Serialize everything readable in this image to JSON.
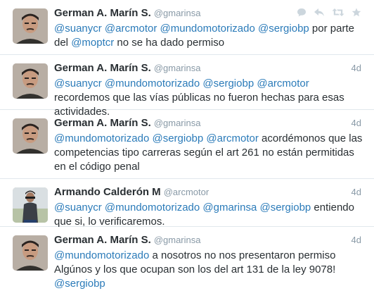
{
  "tweets": [
    {
      "fullname": "German A. Marín S.",
      "username": "@gmarinsa",
      "time": "",
      "show_actions": true,
      "avatar": "photo-man-dark-hair",
      "text_parts": [
        {
          "t": "@suanycr",
          "m": true
        },
        {
          "t": " ",
          "m": false
        },
        {
          "t": "@arcmotor",
          "m": true
        },
        {
          "t": " ",
          "m": false
        },
        {
          "t": "@mundomotorizado",
          "m": true
        },
        {
          "t": " ",
          "m": false
        },
        {
          "t": "@sergiobp",
          "m": true
        },
        {
          "t": " por parte del ",
          "m": false
        },
        {
          "t": "@moptcr",
          "m": true
        },
        {
          "t": "  no se ha dado permiso",
          "m": false
        }
      ]
    },
    {
      "fullname": "German A. Marín S.",
      "username": "@gmarinsa",
      "time": "4d",
      "show_actions": false,
      "avatar": "photo-man-dark-hair",
      "text_parts": [
        {
          "t": "@suanycr",
          "m": true
        },
        {
          "t": " ",
          "m": false
        },
        {
          "t": "@mundomotorizado",
          "m": true
        },
        {
          "t": " ",
          "m": false
        },
        {
          "t": "@sergiobp",
          "m": true
        },
        {
          "t": " ",
          "m": false
        },
        {
          "t": "@arcmotor",
          "m": true
        },
        {
          "t": " recordemos que las vías públicas no fueron hechas para esas actividades.",
          "m": false
        }
      ]
    },
    {
      "fullname": "German A. Marín S.",
      "username": "@gmarinsa",
      "time": "4d",
      "show_actions": false,
      "avatar": "photo-man-dark-hair",
      "text_parts": [
        {
          "t": "@mundomotorizado",
          "m": true
        },
        {
          "t": " ",
          "m": false
        },
        {
          "t": "@sergiobp",
          "m": true
        },
        {
          "t": " ",
          "m": false
        },
        {
          "t": "@arcmotor",
          "m": true
        },
        {
          "t": " acordémonos que las competencias tipo carreras según el art 261 no están permitidas en el código penal",
          "m": false
        }
      ]
    },
    {
      "fullname": "Armando Calderón M",
      "username": "@arcmotor",
      "time": "4d",
      "show_actions": false,
      "avatar": "photo-man-outdoors",
      "text_parts": [
        {
          "t": "@suanycr",
          "m": true
        },
        {
          "t": " ",
          "m": false
        },
        {
          "t": "@mundomotorizado",
          "m": true
        },
        {
          "t": " ",
          "m": false
        },
        {
          "t": "@gmarinsa",
          "m": true
        },
        {
          "t": " ",
          "m": false
        },
        {
          "t": "@sergiobp",
          "m": true
        },
        {
          "t": " entiendo que si, lo verificaremos.",
          "m": false
        }
      ]
    },
    {
      "fullname": "German A. Marín S.",
      "username": "@gmarinsa",
      "time": "4d",
      "show_actions": false,
      "avatar": "photo-man-dark-hair",
      "text_parts": [
        {
          "t": "@mundomotorizado",
          "m": true
        },
        {
          "t": " a nosotros no nos presentaron permiso Algúnos y los que ocupan son los del art 131 de la ley 9078! ",
          "m": false
        },
        {
          "t": "@sergiobp",
          "m": true
        }
      ]
    }
  ],
  "actions": {
    "reply_icon": "reply-icon",
    "retweet_icon": "retweet-icon",
    "favorite_icon": "star-icon",
    "conversation_icon": "conversation-icon"
  },
  "colors": {
    "mention": "#2b7bb9",
    "muted": "#8899a6",
    "text": "#292f33",
    "divider": "#e1e8ed"
  }
}
